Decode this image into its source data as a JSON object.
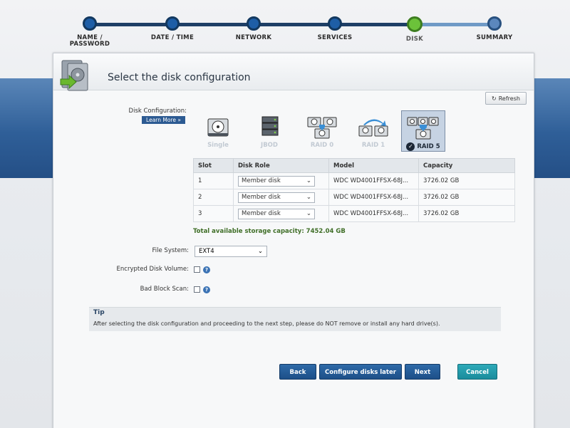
{
  "wizard": {
    "steps": [
      {
        "label": "NAME /\nPASSWORD"
      },
      {
        "label": "DATE / TIME"
      },
      {
        "label": "NETWORK"
      },
      {
        "label": "SERVICES"
      },
      {
        "label": "DISK"
      },
      {
        "label": "SUMMARY"
      }
    ],
    "active_step": 4
  },
  "header": {
    "title": "Select the disk configuration",
    "refresh_label": "Refresh"
  },
  "disk_config": {
    "label": "Disk Configuration:",
    "learn_more": "Learn More »",
    "options": [
      {
        "label": "Single",
        "icon": "single-disk-icon"
      },
      {
        "label": "JBOD",
        "icon": "jbod-disk-icon"
      },
      {
        "label": "RAID 0",
        "icon": "raid0-disk-icon"
      },
      {
        "label": "RAID 1",
        "icon": "raid1-disk-icon"
      },
      {
        "label": "RAID 5",
        "icon": "raid5-disk-icon"
      }
    ],
    "selected": "RAID 5"
  },
  "disk_table": {
    "columns": [
      "Slot",
      "Disk Role",
      "Model",
      "Capacity"
    ],
    "rows": [
      {
        "slot": "1",
        "role": "Member disk",
        "model": "WDC WD4001FFSX-68J...",
        "capacity": "3726.02 GB"
      },
      {
        "slot": "2",
        "role": "Member disk",
        "model": "WDC WD4001FFSX-68J...",
        "capacity": "3726.02 GB"
      },
      {
        "slot": "3",
        "role": "Member disk",
        "model": "WDC WD4001FFSX-68J...",
        "capacity": "3726.02 GB"
      }
    ]
  },
  "total_capacity": "Total available storage capacity: 7452.04 GB",
  "file_system": {
    "label": "File System:",
    "value": "EXT4"
  },
  "encrypted": {
    "label": "Encrypted Disk Volume:"
  },
  "bad_block": {
    "label": "Bad Block Scan:"
  },
  "tip": {
    "title": "Tip",
    "text": "After selecting the disk configuration and proceeding to the next step, please do NOT remove or install any hard drive(s)."
  },
  "buttons": {
    "back": "Back",
    "configure_later": "Configure disks later",
    "next": "Next",
    "cancel": "Cancel"
  },
  "colors": {
    "accent": "#1d4f88",
    "active_step": "#6cc23a",
    "capacity_text": "#3f6e27"
  }
}
